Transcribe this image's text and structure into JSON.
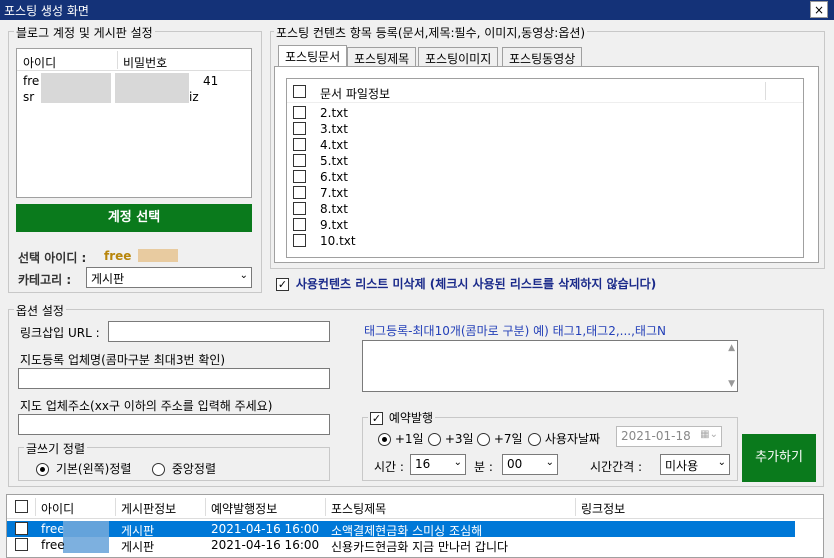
{
  "window": {
    "title": "포스팅 생성 화면",
    "close": "×"
  },
  "blog": {
    "group_label": "블로그 계정 및 게시판 설정",
    "col_id": "아이디",
    "col_pw": "비밀번호",
    "rows": [
      {
        "id": "fre",
        "pw": "41"
      },
      {
        "id": "sr",
        "pw": "iz"
      }
    ],
    "select_button": "계정 선택",
    "selected_id_label": "선택 아이디 :",
    "selected_id_value": "free",
    "category_label": "카테고리 :",
    "category_value": "게시판"
  },
  "content": {
    "group_label": "포스팅 컨텐츠 항목 등록(문서,제목:필수, 이미지,동영상:옵션)",
    "tabs": [
      "포스팅문서",
      "포스팅제목",
      "포스팅이미지",
      "포스팅동영상"
    ],
    "file_header": "문서 파일정보",
    "files": [
      "2.txt",
      "3.txt",
      "4.txt",
      "5.txt",
      "6.txt",
      "7.txt",
      "8.txt",
      "9.txt",
      "10.txt"
    ],
    "keep_list_label": "사용컨텐츠 리스트 미삭제 (체크시 사용된 리스트를 삭제하지 않습니다)"
  },
  "options": {
    "group_label": "옵션 설정",
    "link_url_label": "링크삽입 URL :",
    "map_company_label": "지도등록 업체명(콤마구분 최대3번 확인)",
    "map_address_label": "지도 업체주소(xx구 이하의 주소를 입력해 주세요)",
    "tag_label": "태그등록-최대10개(콤마로 구분) 예) 태그1,태그2,...,태그N",
    "align_label": "글쓰기 정렬",
    "align_left": "기본(왼쪽)정렬",
    "align_center": "중앙정렬",
    "schedule_label": "예약발행",
    "sched_1": "+1일",
    "sched_3": "+3일",
    "sched_7": "+7일",
    "sched_user": "사용자날짜",
    "date_value": "2021-01-18",
    "hour_label": "시간 :",
    "hour_value": "16",
    "minute_label": "분 :",
    "minute_value": "00",
    "interval_label": "시간간격 :",
    "interval_value": "미사용",
    "add_button": "추가하기"
  },
  "table": {
    "headers": [
      "아이디",
      "게시판정보",
      "예약발행정보",
      "포스팅제목",
      "링크정보"
    ],
    "rows": [
      {
        "id": "free",
        "board": "게시판",
        "schedule": "2021-04-16 16:00",
        "title": "소액결제현금화 스미싱 조심해",
        "link": ""
      },
      {
        "id": "free",
        "board": "게시판",
        "schedule": "2021-04-16 16:00",
        "title": "신용카드현금화 지금 만나러 갑니다",
        "link": ""
      }
    ]
  }
}
